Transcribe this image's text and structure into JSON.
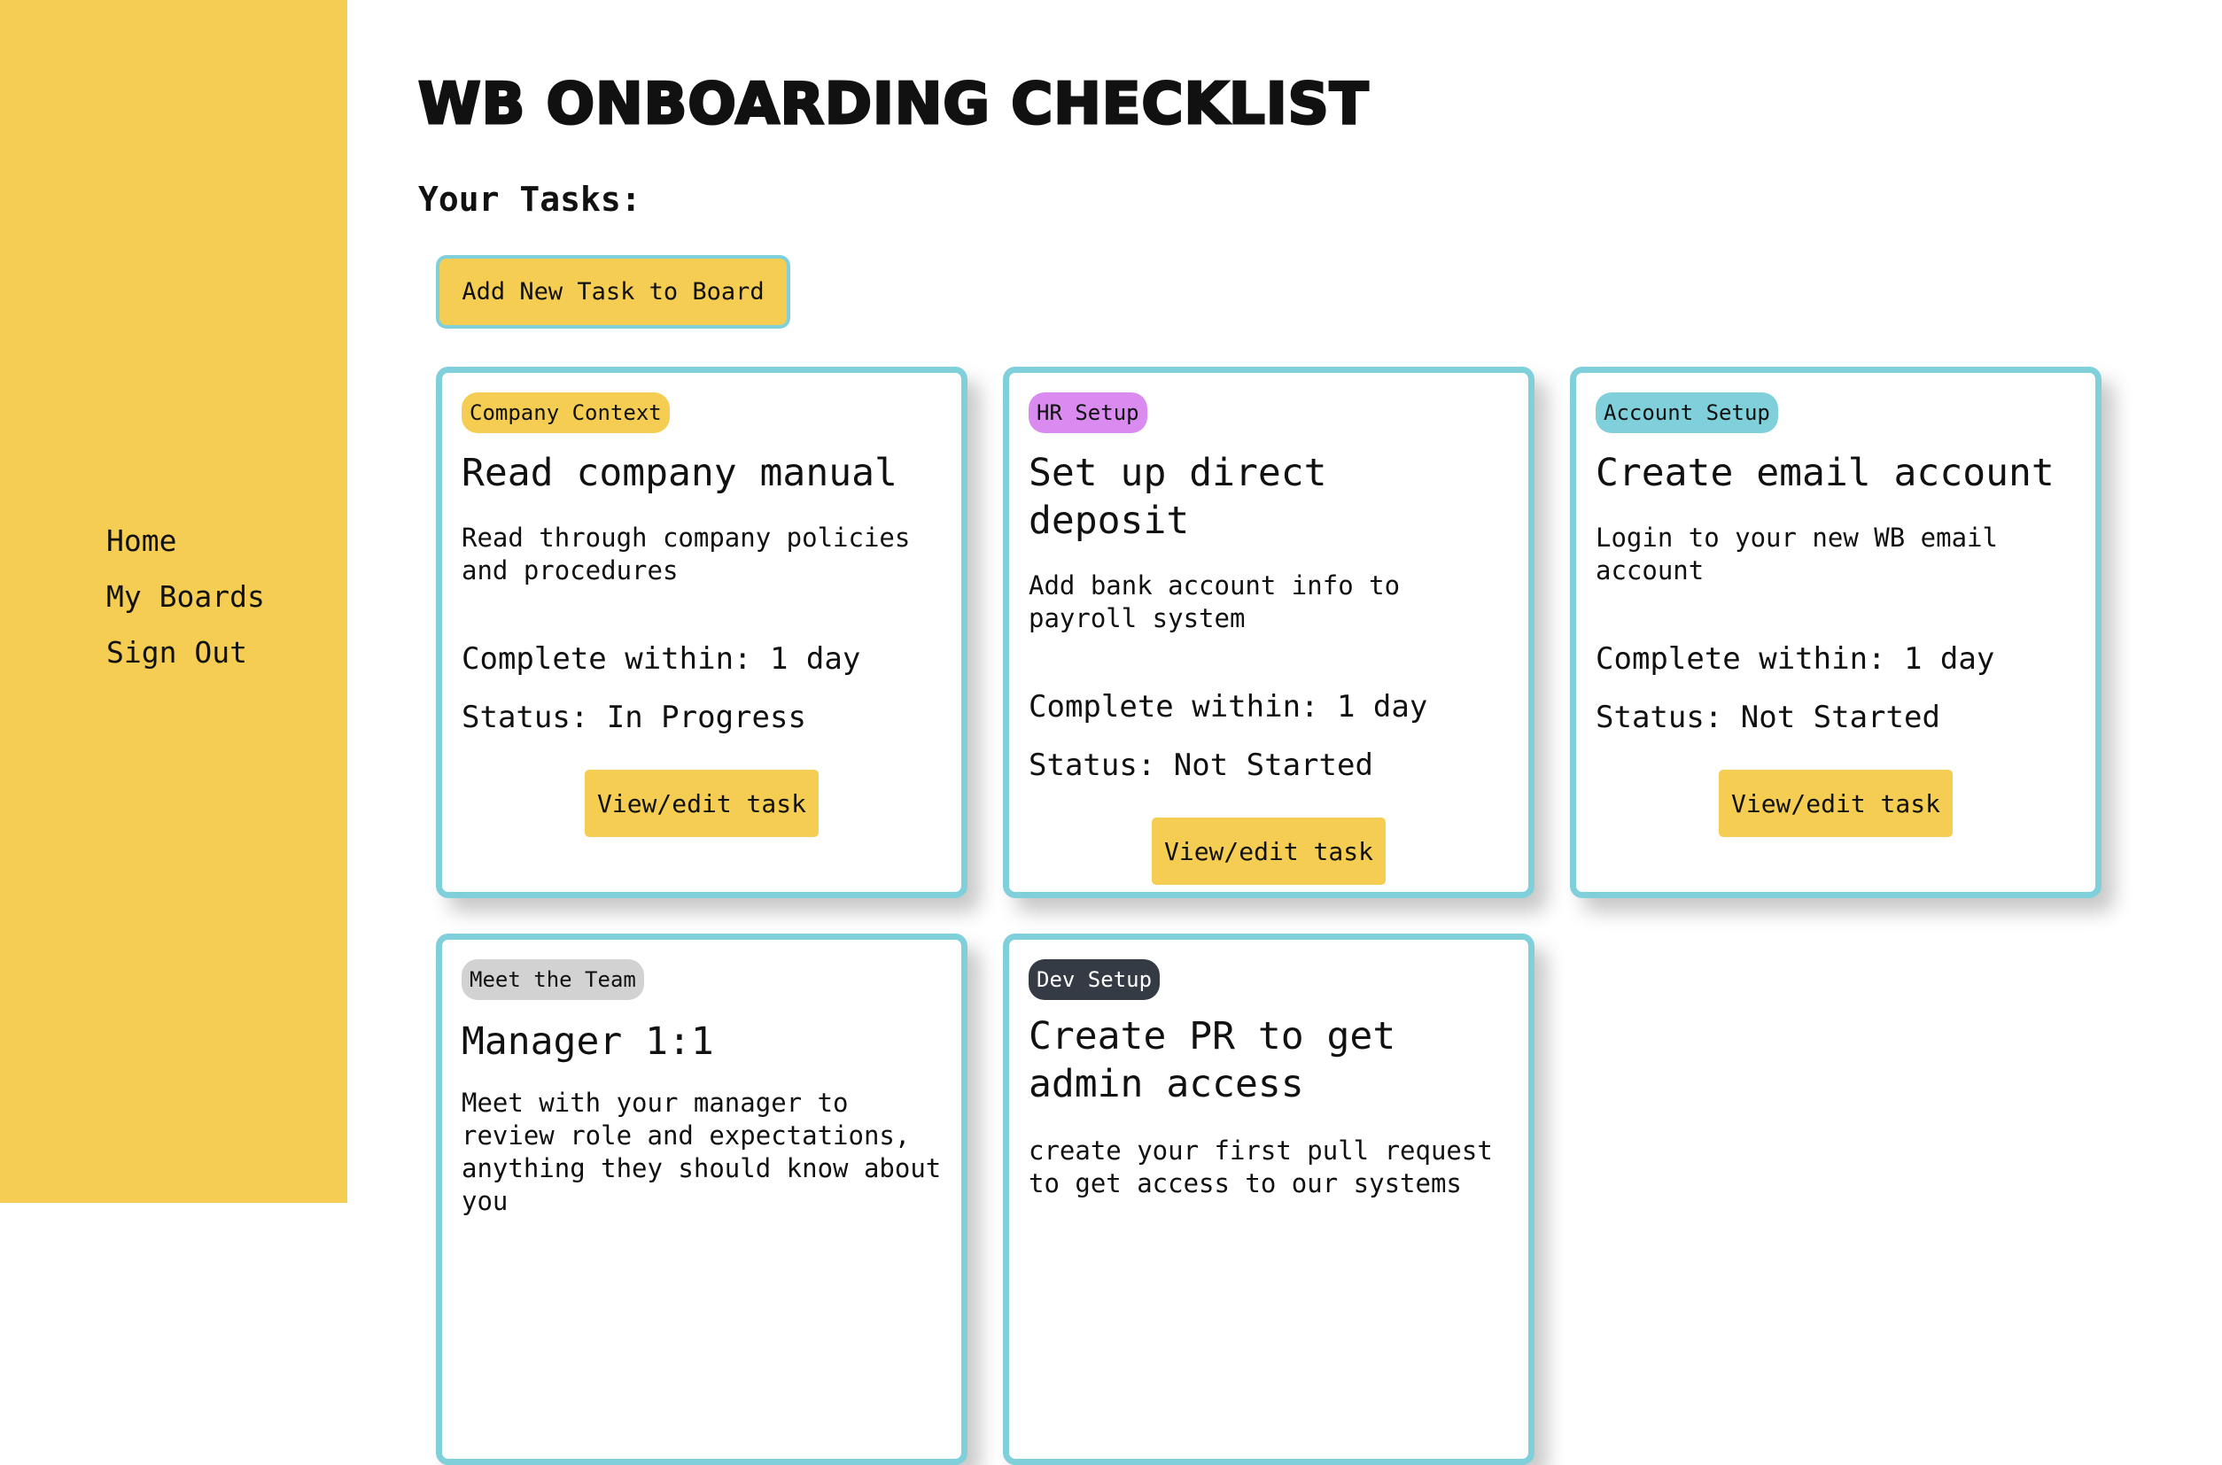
{
  "sidebar": {
    "nav": [
      {
        "label": "Home"
      },
      {
        "label": "My Boards"
      },
      {
        "label": "Sign Out"
      }
    ]
  },
  "main": {
    "title": "WB Onboarding Checklist",
    "tasks_heading": "Your Tasks:",
    "add_task_label": "Add New Task to Board"
  },
  "tasks": [
    {
      "category": "Company Context",
      "category_color": "#f5cd52",
      "category_text_color": "#111111",
      "title": "Read company manual",
      "description": "Read through company policies and procedures",
      "complete_within": "Complete within: 1 day",
      "status": "Status: In Progress",
      "button": "View/edit task"
    },
    {
      "category": "HR Setup",
      "category_color": "#d98bf0",
      "category_text_color": "#111111",
      "title": "Set up direct deposit",
      "description": "Add bank account info to payroll system",
      "complete_within": "Complete within: 1 day",
      "status": "Status: Not Started",
      "button": "View/edit task"
    },
    {
      "category": "Account Setup",
      "category_color": "#7fd0da",
      "category_text_color": "#111111",
      "title": "Create email account",
      "description": "Login to your new WB email account",
      "complete_within": "Complete within: 1 day",
      "status": "Status: Not Started",
      "button": "View/edit task"
    },
    {
      "category": "Meet the Team",
      "category_color": "#d2d2d2",
      "category_text_color": "#111111",
      "title": "Manager 1:1",
      "description": "Meet with your manager to review role and expectations, anything they should know about you"
    },
    {
      "category": "Dev Setup",
      "category_color": "#353b45",
      "category_text_color": "#ffffff",
      "title": "Create PR to get admin access",
      "description": "create your first pull request to get access to our systems"
    }
  ],
  "colors": {
    "accent_yellow": "#f5cd52",
    "border_teal": "#7fd0da"
  }
}
